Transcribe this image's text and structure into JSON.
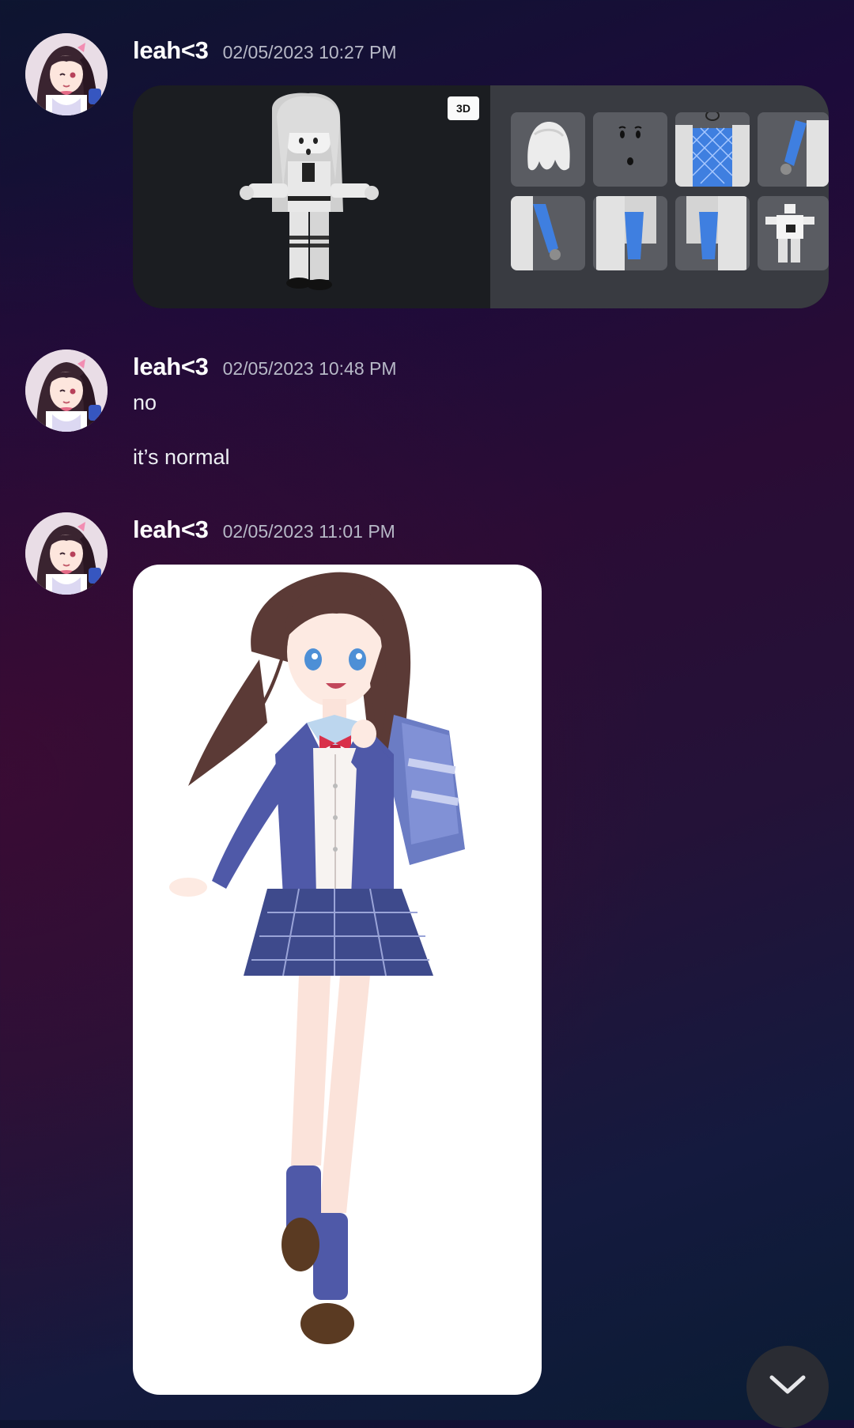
{
  "messages": [
    {
      "username": "leah<3",
      "timestamp": "02/05/2023 10:27 PM",
      "attachment": "roblox-outfit-embed",
      "badge": "3D"
    },
    {
      "username": "leah<3",
      "timestamp": "02/05/2023 10:48 PM",
      "lines": [
        "no",
        "it’s normal"
      ]
    },
    {
      "username": "leah<3",
      "timestamp": "02/05/2023 11:01 PM",
      "attachment": "anime-schoolgirl-image"
    }
  ],
  "icons": {
    "scroll_button": "chevron-down-icon"
  },
  "colors": {
    "username": "#ffffff",
    "timestamp": "#b7b9c7",
    "embed_left_bg": "#1b1d21",
    "embed_right_bg": "#393b41",
    "tile_bg": "#5a5c62"
  }
}
